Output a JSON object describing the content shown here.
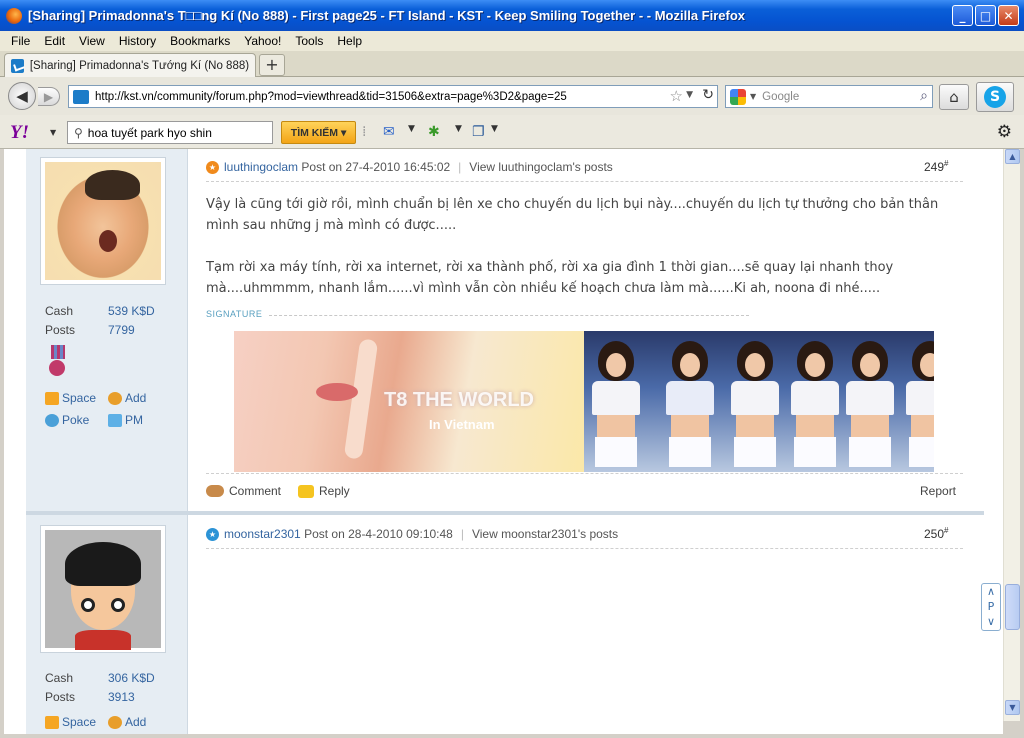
{
  "window": {
    "title": "[Sharing] Primadonna's T□□ng Kí (No 888) - First page25 - FT Island - KST - Keep Smiling Together - - Mozilla Firefox",
    "buttons": {
      "minimize": "_",
      "maximize": "□",
      "close": "✕"
    }
  },
  "menu": [
    "File",
    "Edit",
    "View",
    "History",
    "Bookmarks",
    "Yahoo!",
    "Tools",
    "Help"
  ],
  "tab": {
    "label": "[Sharing] Primadonna's Tướng Kí (No 888) - ...",
    "new_tab": "+"
  },
  "nav": {
    "url": "http://kst.vn/community/forum.php?mod=viewthread&tid=31506&extra=page%3D2&page=25",
    "search_placeholder": "Google"
  },
  "yahoo": {
    "logo": "Y!",
    "query": "hoa tuyết park hyo shin",
    "search_button": "TÌM KIẾM ▾"
  },
  "posts": [
    {
      "author": "luuthingoclam",
      "posted": "Post on 27-4-2010 16:45:02",
      "view_posts": "View luuthingoclam's posts",
      "number": "249",
      "stats": {
        "cash_label": "Cash",
        "cash": "539 K$D",
        "posts_label": "Posts",
        "posts": "7799"
      },
      "links": {
        "space": "Space",
        "add": "Add",
        "poke": "Poke",
        "pm": "PM"
      },
      "body": [
        "Vậy là cũng tới giờ rồi, mình chuẩn bị lên xe cho chuyến du lịch bụi này....chuyến du lịch tự thưởng cho bản thân mình sau những j mà mình có được.....",
        "Tạm rời xa máy tính, rời xa internet, rời xa thành phố, rời xa gia đình 1 thời gian....sẽ quay lại nhanh thoy mà....uhmmmm, nhanh lắm......vì mình vẫn còn nhiều kế hoạch chưa làm mà......Ki ah, noona đi nhé....."
      ],
      "signature_label": "SIGNATURE",
      "banner": {
        "title": "T8 THE WORLD",
        "subtitle": "In Vietnam"
      },
      "actions": {
        "comment": "Comment",
        "reply": "Reply",
        "report": "Report"
      }
    },
    {
      "author": "moonstar2301",
      "posted": "Post on 28-4-2010 09:10:48",
      "view_posts": "View moonstar2301's posts",
      "number": "250",
      "stats": {
        "cash_label": "Cash",
        "cash": "306 K$D",
        "posts_label": "Posts",
        "posts": "3913"
      },
      "links": {
        "space": "Space",
        "add": "Add"
      }
    }
  ],
  "post_num_suffix": "#",
  "scroll_widget": "∧ P ∨"
}
